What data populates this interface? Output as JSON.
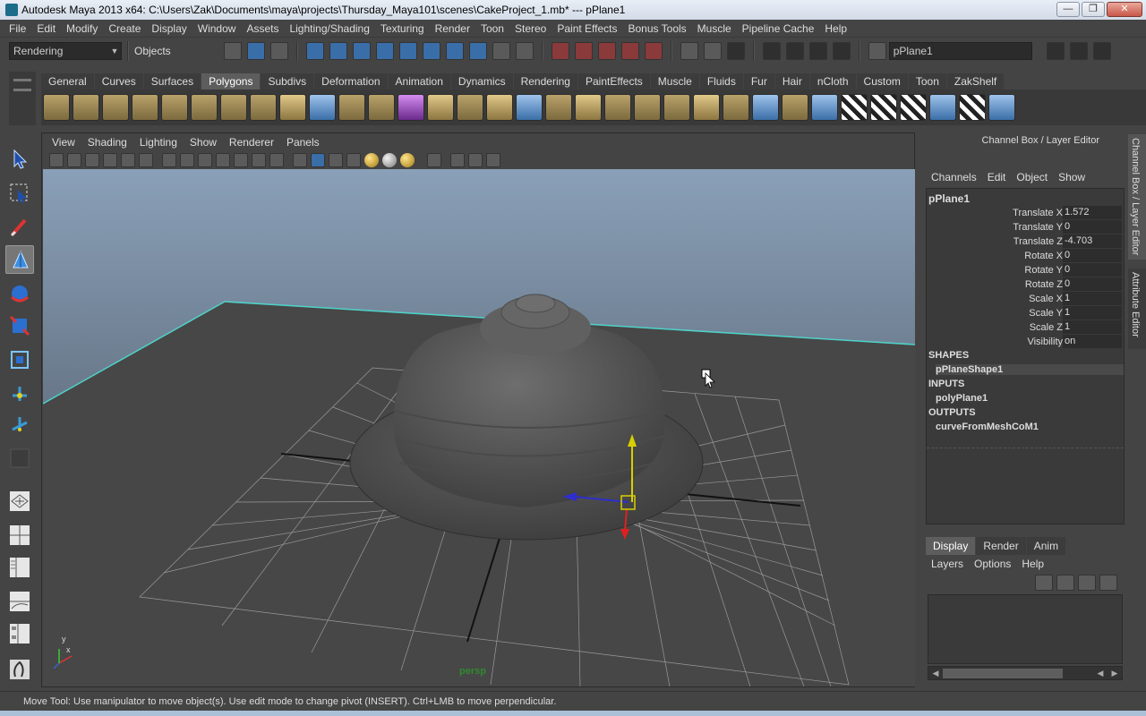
{
  "window": {
    "title": "Autodesk Maya 2013 x64: C:\\Users\\Zak\\Documents\\maya\\projects\\Thursday_Maya101\\scenes\\CakeProject_1.mb*   ---   pPlane1",
    "minimize": "—",
    "maximize": "❐",
    "close": "✕"
  },
  "menubar": [
    "File",
    "Edit",
    "Modify",
    "Create",
    "Display",
    "Window",
    "Assets",
    "Lighting/Shading",
    "Texturing",
    "Render",
    "Toon",
    "Stereo",
    "Paint Effects",
    "Bonus Tools",
    "Muscle",
    "Pipeline Cache",
    "Help"
  ],
  "statusline": {
    "mode": "Rendering",
    "selection_mask": "Objects",
    "name_field": "pPlane1"
  },
  "shelf": {
    "tabs": [
      "General",
      "Curves",
      "Surfaces",
      "Polygons",
      "Subdivs",
      "Deformation",
      "Animation",
      "Dynamics",
      "Rendering",
      "PaintEffects",
      "Muscle",
      "Fluids",
      "Fur",
      "Hair",
      "nCloth",
      "Custom",
      "Toon",
      "ZakShelf"
    ],
    "active_tab": "Polygons"
  },
  "viewport": {
    "menus": [
      "View",
      "Shading",
      "Lighting",
      "Show",
      "Renderer",
      "Panels"
    ],
    "camera_label": "persp",
    "axis_x": "x",
    "axis_y": "y"
  },
  "channel_box": {
    "title": "Channel Box / Layer Editor",
    "menus": [
      "Channels",
      "Edit",
      "Object",
      "Show"
    ],
    "object": "pPlane1",
    "attributes": [
      {
        "label": "Translate X",
        "value": "1.572"
      },
      {
        "label": "Translate Y",
        "value": "0"
      },
      {
        "label": "Translate Z",
        "value": "-4.703"
      },
      {
        "label": "Rotate X",
        "value": "0"
      },
      {
        "label": "Rotate Y",
        "value": "0"
      },
      {
        "label": "Rotate Z",
        "value": "0"
      },
      {
        "label": "Scale X",
        "value": "1"
      },
      {
        "label": "Scale Y",
        "value": "1"
      },
      {
        "label": "Scale Z",
        "value": "1"
      },
      {
        "label": "Visibility",
        "value": "on"
      }
    ],
    "shapes_header": "SHAPES",
    "shape": "pPlaneShape1",
    "inputs_header": "INPUTS",
    "input": "polyPlane1",
    "outputs_header": "OUTPUTS",
    "output": "curveFromMeshCoM1"
  },
  "layer_editor": {
    "tabs": [
      "Display",
      "Render",
      "Anim"
    ],
    "active_tab": "Display",
    "menus": [
      "Layers",
      "Options",
      "Help"
    ]
  },
  "side_tabs": [
    "Channel Box / Layer Editor",
    "Attribute Editor"
  ],
  "helpline": "Move Tool: Use manipulator to move object(s). Use edit mode to change pivot (INSERT).  Ctrl+LMB to move perpendicular.",
  "colors": {
    "background": "#444444",
    "viewport_sky_top": "#8aa0b8",
    "viewport_ground": "#474747",
    "grid": "#9a9a9a",
    "selected_wire": "#4fd2c8",
    "manip_x": "#2e2ecc",
    "manip_y": "#d8d000",
    "manip_z": "#e02020",
    "camera_label": "#2f8a2f"
  }
}
